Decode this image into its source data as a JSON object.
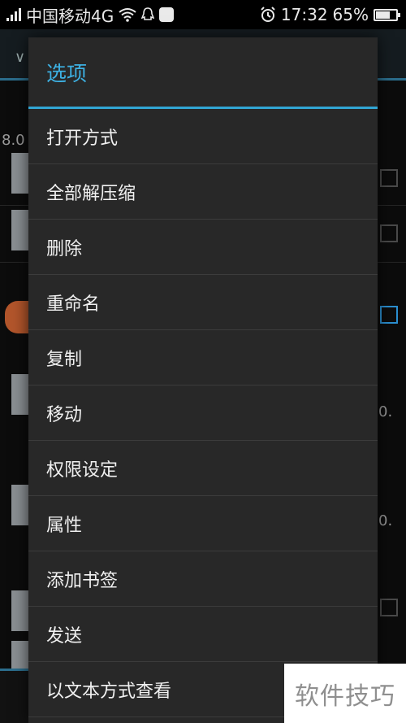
{
  "status_bar": {
    "carrier": "中国移动4G",
    "time": "17:32",
    "battery_percent": "65%",
    "battery_level": 0.65,
    "icons": [
      "signal-icon",
      "wifi-icon",
      "qq-icon",
      "message-icon",
      "alarm-icon",
      "battery-icon"
    ]
  },
  "background": {
    "partial_texts": [
      "8.0",
      "0.",
      "0."
    ]
  },
  "dialog": {
    "title": "选项",
    "items": [
      {
        "label": "打开方式"
      },
      {
        "label": "全部解压缩"
      },
      {
        "label": "删除"
      },
      {
        "label": "重命名"
      },
      {
        "label": "复制"
      },
      {
        "label": "移动"
      },
      {
        "label": "权限设定"
      },
      {
        "label": "属性"
      },
      {
        "label": "添加书签"
      },
      {
        "label": "发送"
      },
      {
        "label": "以文本方式查看"
      }
    ]
  },
  "watermark": "软件技巧",
  "colors": {
    "accent": "#32a6d4",
    "dialog_bg": "#282828",
    "title_text": "#3db1e3"
  }
}
